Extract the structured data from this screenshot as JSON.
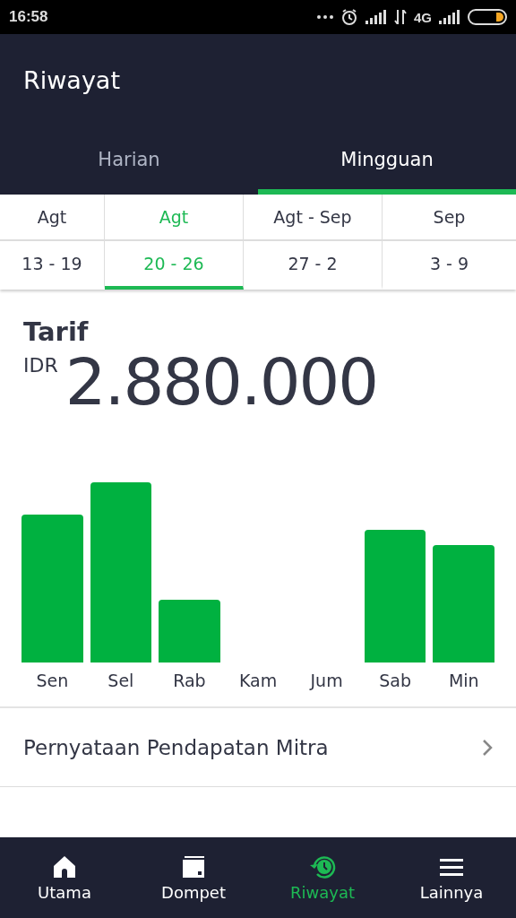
{
  "status_bar": {
    "time": "16:58",
    "network": "4G"
  },
  "header": {
    "title": "Riwayat"
  },
  "tabs": [
    {
      "label": "Harian",
      "selected": false
    },
    {
      "label": "Mingguan",
      "selected": true
    }
  ],
  "weeks": [
    {
      "month": "Agt",
      "range": "13 - 19",
      "selected": false
    },
    {
      "month": "Agt",
      "range": "20 - 26",
      "selected": true
    },
    {
      "month": "Agt - Sep",
      "range": "27 - 2",
      "selected": false
    },
    {
      "month": "Sep",
      "range": "3 - 9",
      "selected": false
    }
  ],
  "summary": {
    "title": "Tarif",
    "currency": "IDR",
    "amount": "2.880.000"
  },
  "chart": {
    "days": [
      "Sen",
      "Sel",
      "Rab",
      "Kam",
      "Jum",
      "Sab",
      "Min"
    ]
  },
  "statement_link": {
    "label": "Pernyataan Pendapatan Mitra"
  },
  "bottom_nav": [
    {
      "label": "Utama",
      "kind": "home",
      "selected": false
    },
    {
      "label": "Dompet",
      "kind": "wallet",
      "selected": false
    },
    {
      "label": "Riwayat",
      "kind": "history",
      "selected": true
    },
    {
      "label": "Lainnya",
      "kind": "menu",
      "selected": false
    }
  ]
}
